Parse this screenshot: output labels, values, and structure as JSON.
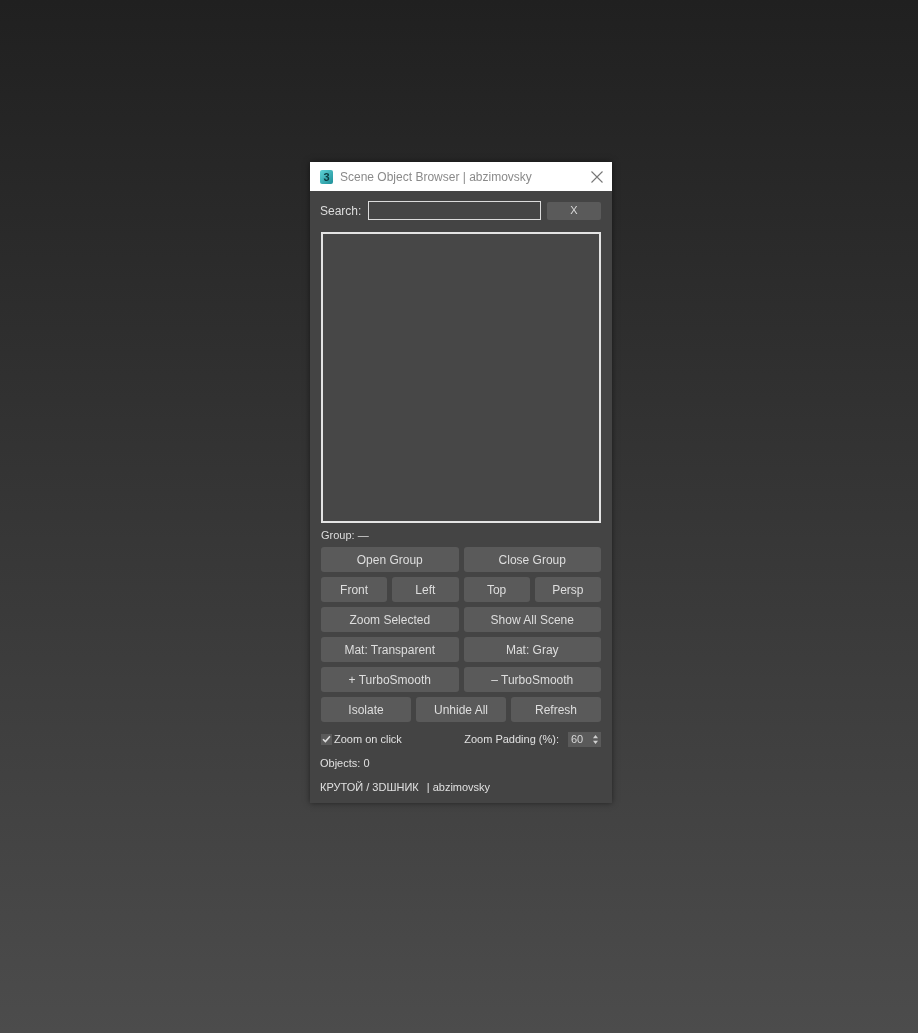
{
  "window": {
    "icon_text": "3",
    "title": "Scene Object Browser | abzimovsky"
  },
  "search": {
    "label": "Search:",
    "clear_button": "X"
  },
  "group": {
    "label": "Group: —"
  },
  "button_rows": [
    {
      "buttons": [
        {
          "label": "Open Group"
        },
        {
          "label": "Close Group"
        }
      ]
    },
    {
      "buttons": [
        {
          "label": "Front"
        },
        {
          "label": "Left"
        },
        {
          "label": "Top"
        },
        {
          "label": "Persp"
        }
      ]
    },
    {
      "buttons": [
        {
          "label": "Zoom Selected"
        },
        {
          "label": "Show All Scene"
        }
      ]
    },
    {
      "buttons": [
        {
          "label": "Mat: Transparent"
        },
        {
          "label": "Mat: Gray"
        }
      ]
    },
    {
      "buttons": [
        {
          "label": "+ TurboSmooth"
        },
        {
          "label": "– TurboSmooth"
        }
      ]
    },
    {
      "buttons": [
        {
          "label": "Isolate"
        },
        {
          "label": "Unhide All"
        },
        {
          "label": "Refresh"
        }
      ]
    }
  ],
  "options": {
    "zoom_on_click": {
      "label": "Zoom on click",
      "checked": true
    },
    "zoom_padding": {
      "label": "Zoom Padding (%):",
      "value": "60"
    }
  },
  "status": {
    "objects": "Objects: 0"
  },
  "footer": [
    "КРУТОЙ / 3DШНИК",
    "| abzimovsky"
  ]
}
